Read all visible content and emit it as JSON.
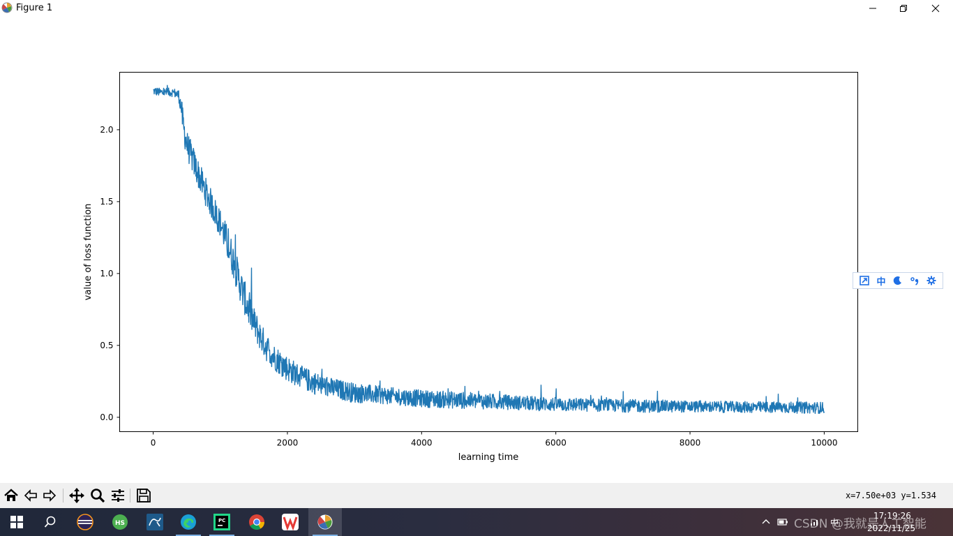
{
  "window": {
    "title": "Figure 1",
    "icon": "matplotlib-icon"
  },
  "chart_data": {
    "type": "line",
    "title": "",
    "xlabel": "learning time",
    "ylabel": "value of loss function",
    "xlim": [
      -500,
      10500
    ],
    "ylim": [
      -0.1,
      2.4
    ],
    "xticks": [
      0,
      2000,
      4000,
      6000,
      8000,
      10000
    ],
    "xtick_labels": [
      "0",
      "2000",
      "4000",
      "6000",
      "8000",
      "10000"
    ],
    "yticks": [
      0.0,
      0.5,
      1.0,
      1.5,
      2.0
    ],
    "ytick_labels": [
      "0.0",
      "0.5",
      "1.0",
      "1.5",
      "2.0"
    ],
    "grid": false,
    "color": "#1f77b4",
    "series": [
      {
        "x": [
          0,
          100,
          200,
          300,
          380,
          420,
          450,
          500,
          600,
          700,
          800,
          900,
          1000,
          1100,
          1200,
          1300,
          1400,
          1500,
          1600,
          1700,
          1800,
          2000,
          2200,
          2400,
          2600,
          2800,
          3000,
          3500,
          4000,
          4500,
          5000,
          5500,
          6000,
          6500,
          7000,
          7500,
          8000,
          8500,
          9000,
          9500,
          10000
        ],
        "y": [
          2.27,
          2.26,
          2.26,
          2.26,
          2.24,
          2.15,
          2.02,
          1.9,
          1.78,
          1.66,
          1.55,
          1.45,
          1.35,
          1.22,
          1.08,
          0.92,
          0.78,
          0.66,
          0.56,
          0.48,
          0.42,
          0.34,
          0.28,
          0.24,
          0.21,
          0.19,
          0.17,
          0.15,
          0.13,
          0.12,
          0.11,
          0.1,
          0.09,
          0.085,
          0.08,
          0.077,
          0.075,
          0.072,
          0.07,
          0.068,
          0.066
        ],
        "noise": [
          0.03,
          0.03,
          0.03,
          0.03,
          0.04,
          0.08,
          0.1,
          0.1,
          0.1,
          0.1,
          0.1,
          0.1,
          0.1,
          0.12,
          0.12,
          0.12,
          0.12,
          0.11,
          0.1,
          0.1,
          0.09,
          0.09,
          0.08,
          0.08,
          0.07,
          0.07,
          0.07,
          0.06,
          0.06,
          0.06,
          0.055,
          0.05,
          0.05,
          0.045,
          0.045,
          0.045,
          0.04,
          0.04,
          0.04,
          0.04,
          0.04
        ]
      }
    ]
  },
  "toolbar": {
    "buttons": [
      "home-icon",
      "back-icon",
      "forward-icon",
      "pan-icon",
      "zoom-icon",
      "configure-subplots-icon",
      "save-icon"
    ],
    "coordinates": "x=7.50e+03 y=1.534"
  },
  "ime_toolbar": {
    "items": [
      "expand-icon",
      "中",
      "moon-icon",
      "punctuation-icon",
      "settings-icon"
    ],
    "color": "#1f6fe5"
  },
  "taskbar": {
    "apps": [
      "start-icon",
      "search-icon",
      "eclipse-icon",
      "hbuilder-icon",
      "mysql-workbench-icon",
      "edge-icon",
      "pycharm-icon",
      "chrome-icon",
      "wps-icon",
      "matplotlib-icon"
    ],
    "tray": [
      "chevron-up-icon",
      "battery-icon",
      "network-icon",
      "中"
    ],
    "time": "17:19:26",
    "date": "2022/11/25",
    "watermark": "CSDN @我就是人工智能"
  }
}
